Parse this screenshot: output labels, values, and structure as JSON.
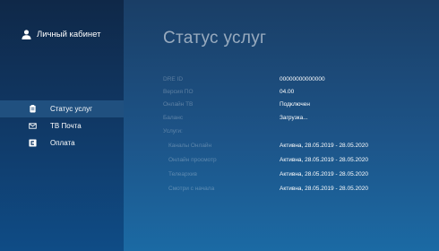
{
  "sidebar": {
    "profile_label": "Личный кабинет",
    "items": [
      {
        "label": "Статус услуг",
        "icon": "clipboard-icon",
        "active": true
      },
      {
        "label": "ТВ Почта",
        "icon": "mail-icon",
        "active": false
      },
      {
        "label": "Оплата",
        "icon": "payment-icon",
        "active": false
      }
    ]
  },
  "main": {
    "title": "Статус услуг",
    "rows": [
      {
        "label": "DRE ID",
        "value": "00000000000000"
      },
      {
        "label": "Версия ПО",
        "value": "04.00"
      },
      {
        "label": "Онлайн ТВ",
        "value": "Подключен"
      },
      {
        "label": "Баланс",
        "value": "Загрузка..."
      },
      {
        "label": "Услуги:",
        "value": ""
      },
      {
        "label": "Каналы Онлайн",
        "value": "Активна, 28.05.2019 - 28.05.2020"
      },
      {
        "label": "Онлайн просмотр",
        "value": "Активна, 28.05.2019 - 28.05.2020"
      },
      {
        "label": "Телеархив",
        "value": "Активна, 28.05.2019 - 28.05.2020"
      },
      {
        "label": "Смотри с начала",
        "value": "Активна, 28.05.2019 - 28.05.2020"
      }
    ]
  },
  "colors": {
    "background": "#1d5488",
    "sidebar": "#103763",
    "active_item": "#20507f"
  }
}
